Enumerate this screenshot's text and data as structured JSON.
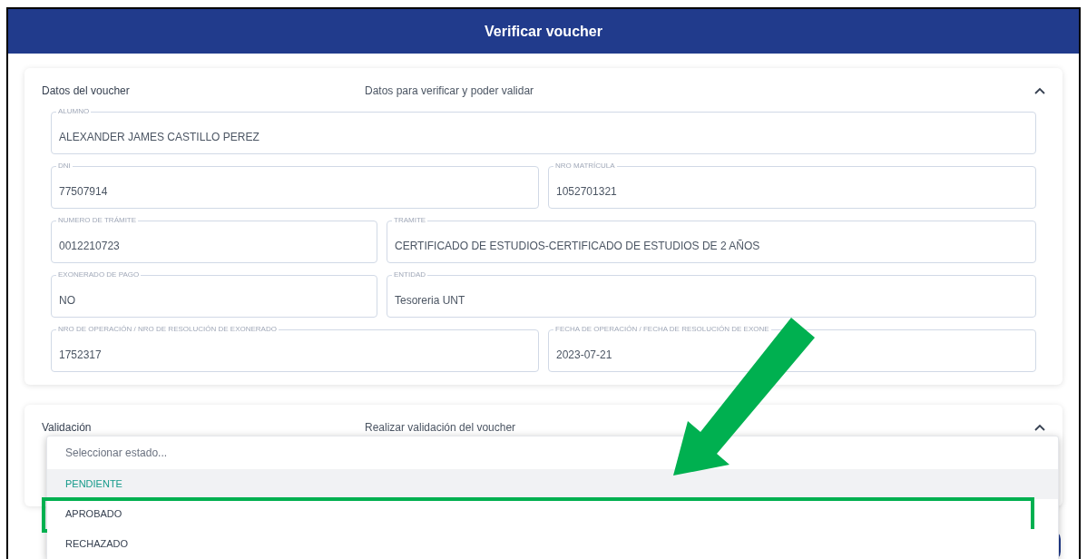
{
  "window": {
    "title": "Verificar voucher"
  },
  "sections": [
    {
      "title": "Datos del voucher",
      "subtitle": "Datos para verificar y poder validar",
      "expanded": true,
      "rows": [
        [
          {
            "label": "ALUMNO",
            "value": "ALEXANDER JAMES CASTILLO PEREZ"
          }
        ],
        [
          {
            "label": "DNI",
            "value": "77507914"
          },
          {
            "label": "NRO MATRÍCULA",
            "value": "1052701321"
          }
        ],
        [
          {
            "label": "NUMERO DE TRÁMITE",
            "value": "0012210723"
          },
          {
            "label": "TRAMITE",
            "value": "CERTIFICADO DE ESTUDIOS-CERTIFICADO DE ESTUDIOS DE 2 AÑOS"
          }
        ],
        [
          {
            "label": "EXONERADO DE PAGO",
            "value": "NO"
          },
          {
            "label": "ENTIDAD",
            "value": "Tesoreria UNT"
          }
        ],
        [
          {
            "label": "NRO DE OPERACIÓN / NRO DE RESOLUCIÓN DE EXONERADO",
            "value": "1752317"
          },
          {
            "label": "FECHA DE OPERACIÓN / FECHA DE RESOLUCIÓN DE EXONE",
            "value": "2023-07-21"
          }
        ]
      ]
    },
    {
      "title": "Validación",
      "subtitle": "Realizar validación del voucher",
      "expanded": true
    }
  ],
  "dropdown": {
    "placeholder": "Seleccionar estado...",
    "options": [
      {
        "label": "PENDIENTE",
        "selected": true,
        "highlighted": false
      },
      {
        "label": "APROBADO",
        "selected": false,
        "highlighted": true
      },
      {
        "label": "RECHAZADO",
        "selected": false,
        "highlighted": false
      }
    ]
  }
}
